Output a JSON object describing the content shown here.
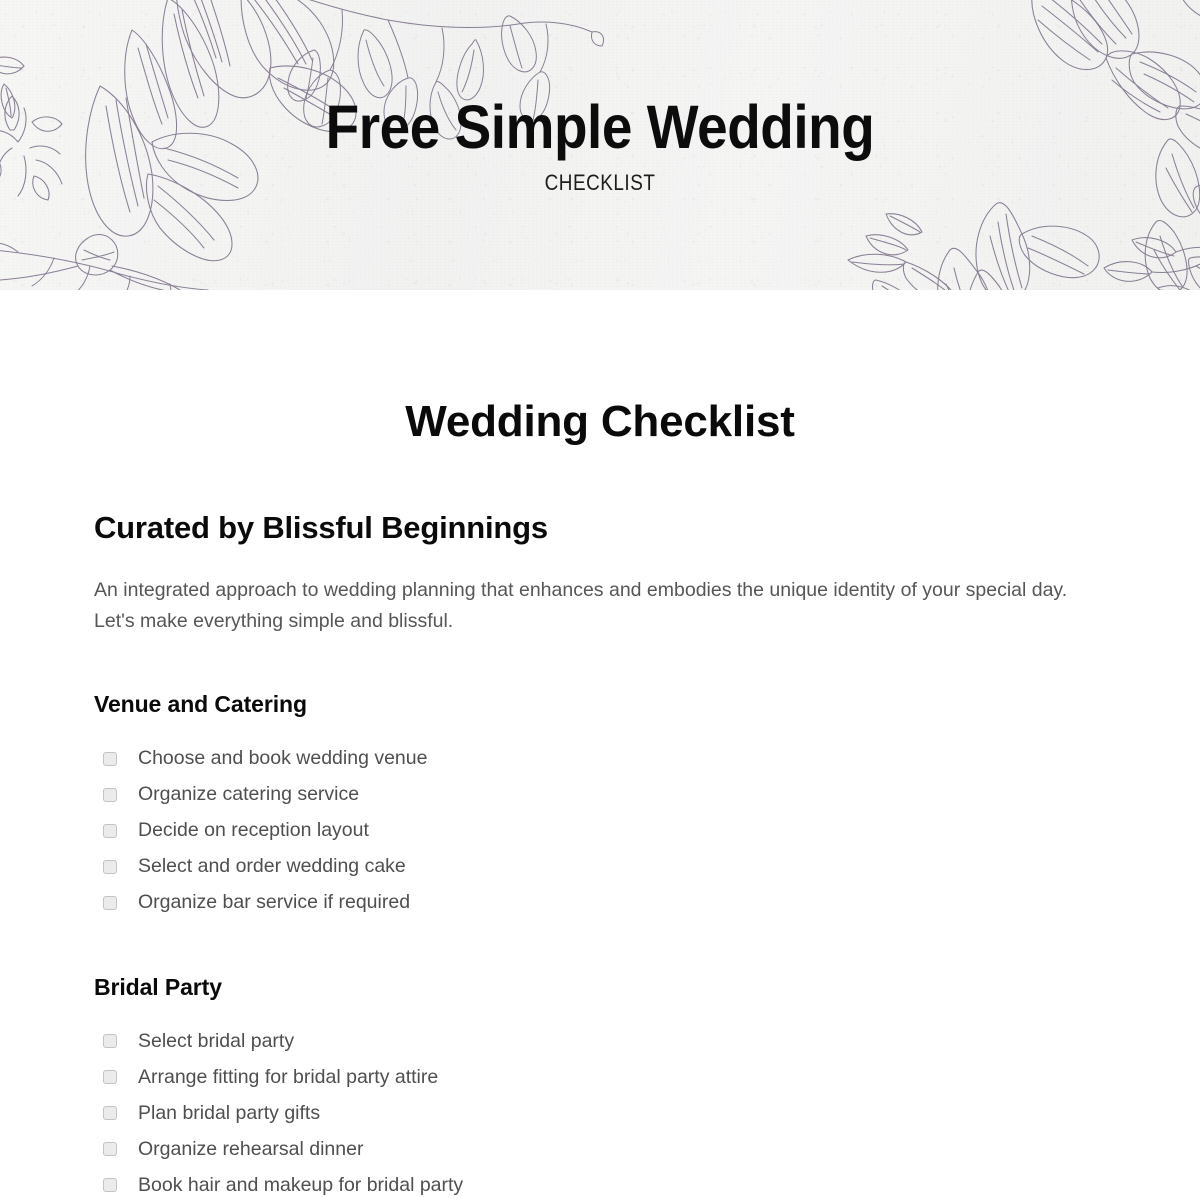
{
  "header": {
    "title": "Free Simple Wedding",
    "subtitle": "CHECKLIST",
    "background_color": "#f4f4f3",
    "floral_ink_color": "#8a7f95",
    "title_color": "#0c0c0c"
  },
  "document": {
    "title": "Wedding Checklist",
    "subtitle": "Curated by Blissful Beginnings",
    "intro": "An integrated approach to wedding planning that enhances and embodies the unique identity of your special day. Let's make everything simple and blissful.",
    "text_color": "#565656",
    "heading_color": "#0a0a0a",
    "sections": [
      {
        "heading": "Venue and Catering",
        "items": [
          {
            "label": "Choose and book wedding venue",
            "checked": false
          },
          {
            "label": "Organize catering service",
            "checked": false
          },
          {
            "label": "Decide on reception layout",
            "checked": false
          },
          {
            "label": "Select and order wedding cake",
            "checked": false
          },
          {
            "label": "Organize bar service if required",
            "checked": false
          }
        ]
      },
      {
        "heading": "Bridal Party",
        "items": [
          {
            "label": "Select bridal party",
            "checked": false
          },
          {
            "label": "Arrange fitting for bridal party attire",
            "checked": false
          },
          {
            "label": "Plan bridal party gifts",
            "checked": false
          },
          {
            "label": "Organize rehearsal dinner",
            "checked": false
          },
          {
            "label": "Book hair and makeup for bridal party",
            "checked": false
          }
        ]
      }
    ]
  }
}
